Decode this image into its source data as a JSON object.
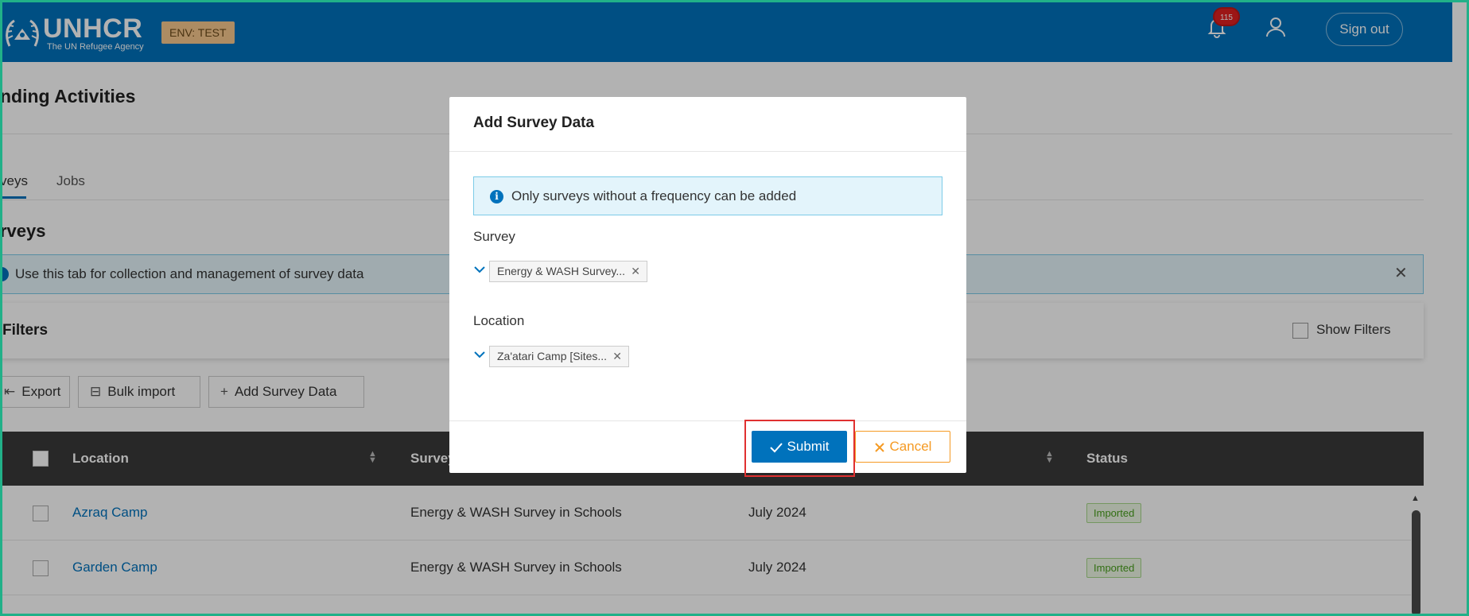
{
  "header": {
    "logo_main": "UNHCR",
    "logo_sub": "The UN Refugee Agency",
    "env_badge": "ENV: TEST",
    "notification_count": "115",
    "signout_label": "Sign out",
    "brand_color": "#0072bc"
  },
  "page": {
    "title": "nding Activities",
    "tabs": [
      {
        "label": "veys",
        "active": true
      },
      {
        "label": "Jobs",
        "active": false
      }
    ],
    "section_title": "rveys",
    "info_banner": "Use this tab for collection and management of survey data",
    "filters_label": "Filters",
    "show_filters_label": "Show Filters",
    "actions": {
      "export": "Export",
      "bulk_import": "Bulk import",
      "add_survey": "Add Survey Data"
    }
  },
  "table": {
    "columns": [
      "Location",
      "Survey",
      "Status"
    ],
    "rows": [
      {
        "location": "Azraq Camp",
        "survey": "Energy & WASH Survey in Schools",
        "period": "July 2024",
        "status": "Imported"
      },
      {
        "location": "Garden Camp",
        "survey": "Energy & WASH Survey in Schools",
        "period": "July 2024",
        "status": "Imported"
      }
    ]
  },
  "modal": {
    "title": "Add Survey Data",
    "info": "Only surveys without a frequency can be added",
    "survey_label": "Survey",
    "survey_tag": "Energy & WASH Survey...",
    "location_label": "Location",
    "location_tag": "Za'atari Camp [Sites...",
    "submit_label": "Submit",
    "cancel_label": "Cancel"
  }
}
